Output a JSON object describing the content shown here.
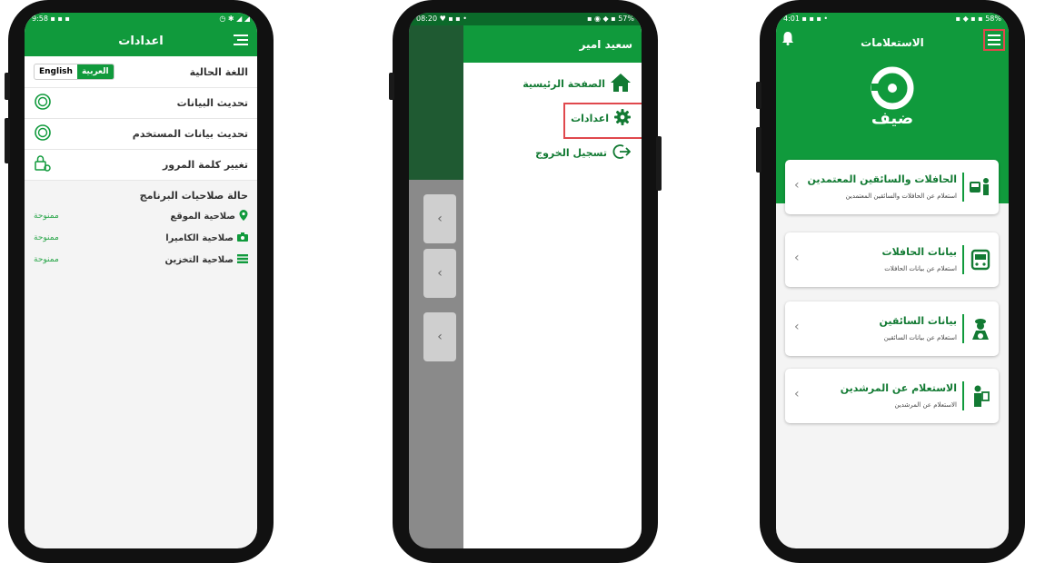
{
  "phone1": {
    "status_left": "9:58 ▪ ▪ ▪",
    "status_right": "◷ ✱ ◢ ◢",
    "title": "اعدادات",
    "current_language_label": "اللغة الحالية",
    "lang_options": [
      "English",
      "العربية"
    ],
    "lang_selected": "العربية",
    "rows": [
      {
        "label": "تحديث البيانات",
        "icon": "sync-icon"
      },
      {
        "label": "تحديث بيانات المستخدم",
        "icon": "sync-icon"
      },
      {
        "label": "تغيير كلمة المرور",
        "icon": "lock-refresh-icon"
      }
    ],
    "permissions_title": "حالة صلاحيات البرنامج",
    "permissions": [
      {
        "label": "صلاحية الموقع",
        "status": "ممنوحة",
        "icon": "location-pin-icon"
      },
      {
        "label": "صلاحية الكاميرا",
        "status": "ممنوحة",
        "icon": "camera-icon"
      },
      {
        "label": "صلاحية التخزين",
        "status": "ممنوحة",
        "icon": "storage-icon"
      }
    ]
  },
  "phone2": {
    "status_left": "08:20 ♥ ▪ ▪ •",
    "status_right": "▪ ◉ ◆ ▪ 57%",
    "user_name": "سعيد امير",
    "menu": [
      {
        "label": "الصفحة الرئيسية",
        "icon": "home-icon"
      },
      {
        "label": "اعدادات",
        "icon": "gear-icon"
      },
      {
        "label": "تسجيل الخروج",
        "icon": "logout-icon"
      }
    ]
  },
  "phone3": {
    "status_left": "4:01 ▪ ▪ ▪ •",
    "status_right": "▪ ◆ ▪ ▪ 58%",
    "title": "الاستعلامات",
    "logo_text": "ضيف",
    "cards": [
      {
        "title": "الحافلات والسائقين المعتمدين",
        "subtitle": "استعلام عن الحافلات والسائقين المعتمدين",
        "icon": "bus-driver-icon"
      },
      {
        "title": "بيانات الحافلات",
        "subtitle": "استعلام عن بيانات الحافلات",
        "icon": "bus-icon"
      },
      {
        "title": "بيانات السائقين",
        "subtitle": "استعلام عن بيانات السائقين",
        "icon": "driver-icon"
      },
      {
        "title": "الاستعلام عن المرشدين",
        "subtitle": "الاستعلام عن المرشدين",
        "icon": "guide-icon"
      }
    ]
  },
  "colors": {
    "primary": "#109a3c",
    "primary_dark": "#127a33",
    "highlight": "#e0484d",
    "status_ok": "#2aa64a"
  }
}
